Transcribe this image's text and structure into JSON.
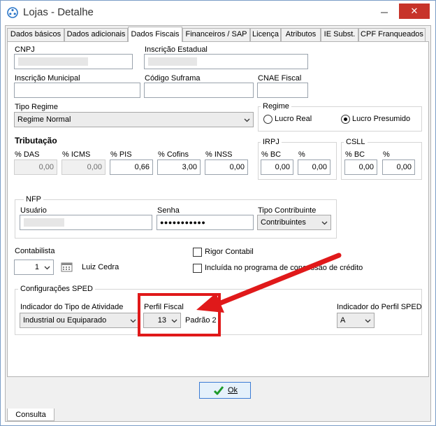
{
  "window": {
    "title": "Lojas - Detalhe",
    "close_glyph": "✕"
  },
  "colors": {
    "accent": "#3b7bd4",
    "highlight": "#e0191a",
    "close": "#c7342a"
  },
  "tabs": [
    {
      "label": "Dados básicos"
    },
    {
      "label": "Dados adicionais"
    },
    {
      "label": "Dados Fiscais"
    },
    {
      "label": "Financeiros / SAP"
    },
    {
      "label": "Licença"
    },
    {
      "label": "Atributos"
    },
    {
      "label": "IE Subst."
    },
    {
      "label": "CPF Franqueados"
    }
  ],
  "fiscal": {
    "cnpj_label": "CNPJ",
    "inscricao_estadual_label": "Inscrição Estadual",
    "inscricao_municipal_label": "Inscrição Municipal",
    "codigo_suframa_label": "Código Suframa",
    "cnae_label": "CNAE Fiscal",
    "tipo_regime_label": "Tipo Regime",
    "tipo_regime_value": "Regime Normal",
    "regime": {
      "title": "Regime",
      "lucro_real": "Lucro Real",
      "lucro_presumido": "Lucro Presumido",
      "selected": "Lucro Presumido"
    }
  },
  "tributacao": {
    "title": "Tributação",
    "das_label": "% DAS",
    "das_value": "0,00",
    "icms_label": "% ICMS",
    "icms_value": "0,00",
    "pis_label": "% PIS",
    "pis_value": "0,66",
    "cofins_label": "% Cofins",
    "cofins_value": "3,00",
    "inss_label": "% INSS",
    "inss_value": "0,00",
    "irpj": {
      "title": "IRPJ",
      "bc_label": "% BC",
      "pct_label": "%",
      "bc_value": "0,00",
      "pct_value": "0,00"
    },
    "csll": {
      "title": "CSLL",
      "bc_label": "% BC",
      "pct_label": "%",
      "bc_value": "0,00",
      "pct_value": "0,00"
    }
  },
  "nfp": {
    "title": "NFP",
    "usuario_label": "Usuário",
    "senha_label": "Senha",
    "senha_value": "●●●●●●●●●●●",
    "tipo_contribuinte_label": "Tipo Contribuinte",
    "tipo_contribuinte_value": "Contribuintes"
  },
  "contabilista": {
    "label": "Contabilista",
    "value": "1",
    "name": "Luiz Cedra",
    "rigor_contabil": "Rigor Contabil",
    "incluida": "Incluída no programa de concessão de crédito"
  },
  "sped": {
    "title": "Configurações SPED",
    "indicador_atividade_label": "Indicador do Tipo de Atividade",
    "indicador_atividade_value": "Industrial ou Equiparado",
    "perfil_fiscal_label": "Perfil Fiscal",
    "perfil_fiscal_value": "13",
    "perfil_fiscal_desc": "Padrão 2",
    "indicador_perfil_label": "Indicador do Perfil SPED",
    "indicador_perfil_value": "A"
  },
  "footer": {
    "ok_label": "Ok",
    "status_tab": "Consulta"
  }
}
